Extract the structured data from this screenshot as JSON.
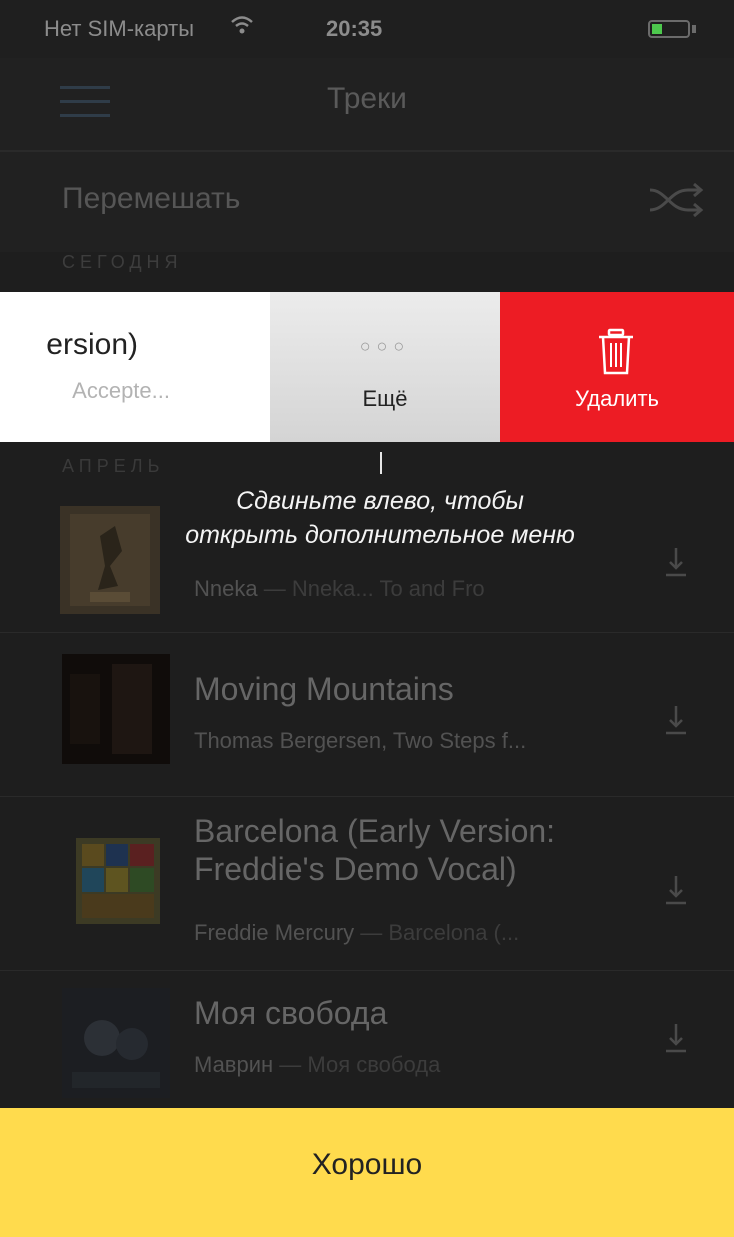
{
  "status_bar": {
    "carrier": "Нет SIM-карты",
    "time": "20:35",
    "wifi_icon": "wifi-icon",
    "battery_icon": "battery-icon"
  },
  "navbar": {
    "title": "Треки",
    "menu_icon": "hamburger-menu-icon"
  },
  "shuffle": {
    "label": "Перемешать",
    "icon": "shuffle-icon"
  },
  "sections": {
    "today": "СЕГОДНЯ",
    "april": "АПРЕЛЬ"
  },
  "swiped_row": {
    "title_partial": "ersion)",
    "subtitle_partial": "Accepte...",
    "more_label": "Ещё",
    "more_icon": "more-dots-icon",
    "delete_label": "Удалить",
    "delete_icon": "trash-icon"
  },
  "hint": {
    "line1": "Сдвиньте влево, чтобы",
    "line2": "открыть дополнительное меню"
  },
  "tracks": [
    {
      "title": "",
      "artist": "Nneka",
      "sub_rest": " — Nneka... To and Fro",
      "icon": "download-icon"
    },
    {
      "title": "Moving Mountains",
      "artist": "Thomas Bergersen, Two Steps f...",
      "sub_rest": "",
      "icon": "download-icon"
    },
    {
      "title": "Barcelona (Early Version:",
      "title_line2": "Freddie's Demo Vocal)",
      "artist": "Freddie Mercury",
      "sub_rest": " — Barcelona (...",
      "icon": "download-icon"
    },
    {
      "title": "Моя свобода",
      "artist": "Маврин",
      "sub_rest": " — Моя свобода",
      "icon": "download-icon"
    }
  ],
  "ok_button": {
    "label": "Хорошо"
  },
  "colors": {
    "accent_yellow": "#ffdb4d",
    "delete_red": "#ed1c24",
    "overlay_bg": "#1e1e1e"
  }
}
